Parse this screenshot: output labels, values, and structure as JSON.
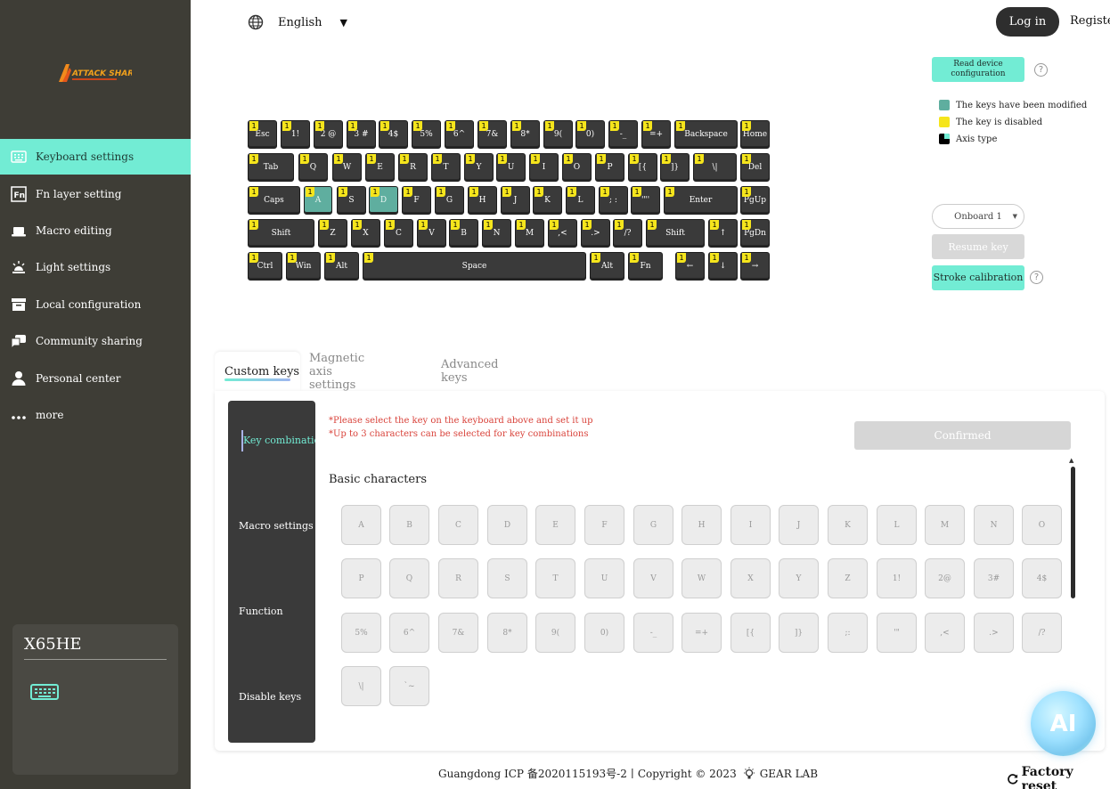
{
  "sidebar": {
    "logo_text": "ATTACK SHARK",
    "items": [
      {
        "label": "Keyboard settings",
        "icon": "keyboard-icon",
        "active": true
      },
      {
        "label": "Fn layer setting",
        "icon": "fn-icon"
      },
      {
        "label": "Macro editing",
        "icon": "laptop-icon"
      },
      {
        "label": "Light settings",
        "icon": "light-icon"
      },
      {
        "label": "Local configuration",
        "icon": "archive-icon"
      },
      {
        "label": "Community sharing",
        "icon": "chat-icon"
      },
      {
        "label": "Personal center",
        "icon": "user-icon"
      },
      {
        "label": "more",
        "icon": "more-icon"
      }
    ],
    "device": {
      "name": "X65HE",
      "icon": "keyboard-icon"
    }
  },
  "header": {
    "language": "English",
    "login": "Log in",
    "register": "Register"
  },
  "right_panel": {
    "read_config": "Read device configuration",
    "legend": [
      {
        "label": "The keys have been modified",
        "color": "#5fae9f"
      },
      {
        "label": "The key is disabled",
        "color": "#f5e51c"
      },
      {
        "label": "Axis type",
        "color": "#000000"
      }
    ],
    "onboard": "Onboard 1",
    "resume_key": "Resume key",
    "stroke_calibration": "Stroke calibration"
  },
  "keyboard": {
    "layer_badge": "1",
    "rows": [
      [
        {
          "l": "Esc"
        },
        {
          "l": "1!"
        },
        {
          "l": "2 @"
        },
        {
          "l": "3 #"
        },
        {
          "l": "4$"
        },
        {
          "l": "5%"
        },
        {
          "l": "6^"
        },
        {
          "l": "7&"
        },
        {
          "l": "8*"
        },
        {
          "l": "9("
        },
        {
          "l": "0)"
        },
        {
          "l": "-_"
        },
        {
          "l": "=+"
        },
        {
          "l": "Backspace"
        },
        {
          "l": "Home"
        }
      ],
      [
        {
          "l": "Tab"
        },
        {
          "l": "Q"
        },
        {
          "l": "W"
        },
        {
          "l": "E"
        },
        {
          "l": "R"
        },
        {
          "l": "T"
        },
        {
          "l": "Y"
        },
        {
          "l": "U"
        },
        {
          "l": "I"
        },
        {
          "l": "O"
        },
        {
          "l": "P"
        },
        {
          "l": "[{"
        },
        {
          "l": "]}"
        },
        {
          "l": "\\|"
        },
        {
          "l": "Del"
        }
      ],
      [
        {
          "l": "Caps"
        },
        {
          "l": "A",
          "mod": true
        },
        {
          "l": "S"
        },
        {
          "l": "D",
          "mod": true
        },
        {
          "l": "F"
        },
        {
          "l": "G"
        },
        {
          "l": "H"
        },
        {
          "l": "J"
        },
        {
          "l": "K"
        },
        {
          "l": "L"
        },
        {
          "l": "; :"
        },
        {
          "l": "'\"'"
        },
        {
          "l": "Enter"
        },
        {
          "l": "PgUp"
        }
      ],
      [
        {
          "l": "Shift"
        },
        {
          "l": "Z"
        },
        {
          "l": "X"
        },
        {
          "l": "C"
        },
        {
          "l": "V"
        },
        {
          "l": "B"
        },
        {
          "l": "N"
        },
        {
          "l": "M"
        },
        {
          "l": ",<"
        },
        {
          "l": ".>"
        },
        {
          "l": "/?"
        },
        {
          "l": "Shift"
        },
        {
          "l": "↑"
        },
        {
          "l": "PgDn"
        }
      ],
      [
        {
          "l": "Ctrl"
        },
        {
          "l": "Win"
        },
        {
          "l": "Alt"
        },
        {
          "l": "Space"
        },
        {
          "l": "Alt"
        },
        {
          "l": "Fn"
        },
        {
          "l": "←"
        },
        {
          "l": "↓"
        },
        {
          "l": "→"
        }
      ]
    ]
  },
  "tabs": [
    {
      "label": "Custom keys",
      "active": true
    },
    {
      "label": "Magnetic axis settings"
    },
    {
      "label": "Advanced keys"
    }
  ],
  "subnav": [
    {
      "label": "Key combination",
      "active": true
    },
    {
      "label": "Macro settings"
    },
    {
      "label": "Function"
    },
    {
      "label": "Disable keys"
    }
  ],
  "content": {
    "notice1": "*Please select the key on the keyboard above and set it up",
    "notice2": "*Up to 3 characters can be selected for key combinations",
    "confirmed": "Confirmed",
    "section_title": "Basic characters",
    "chars": [
      [
        "A",
        "B",
        "C",
        "D",
        "E",
        "F",
        "G",
        "H",
        "I",
        "J",
        "K",
        "L",
        "M",
        "N",
        "O"
      ],
      [
        "P",
        "Q",
        "R",
        "S",
        "T",
        "U",
        "V",
        "W",
        "X",
        "Y",
        "Z",
        "1!",
        "2@",
        "3#",
        "4$"
      ],
      [
        "5%",
        "6^",
        "7&",
        "8*",
        "9(",
        "0)",
        "-_",
        "=+",
        "[{",
        "]}",
        ";:",
        "'\"",
        ",<",
        ".>",
        "/?"
      ],
      [
        "\\|",
        "`~"
      ]
    ]
  },
  "ai_button": "AI",
  "footer": {
    "text": "Guangdong ICP 备2020115193号-2丨Copyright © 2023",
    "brand": "GEAR LAB",
    "factory_reset": "Factory reset"
  }
}
